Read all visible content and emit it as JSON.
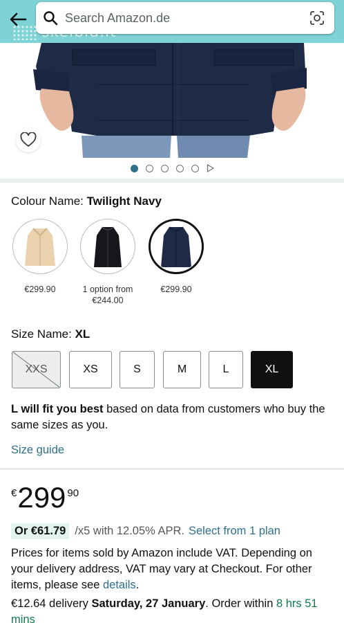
{
  "search": {
    "placeholder": "Search Amazon.de",
    "watermark": "skelbiu.lt"
  },
  "carousel": {
    "dot_count": 5,
    "active_index": 0
  },
  "colour": {
    "label": "Colour Name: ",
    "selected_value": "Twilight Navy",
    "options": [
      {
        "color": "#e9d2ad",
        "price": "€299.90"
      },
      {
        "color": "#16171a",
        "price": "1 option from €244.00"
      },
      {
        "color": "#1f2a47",
        "price": "€299.90"
      }
    ]
  },
  "size": {
    "label": "Size Name: ",
    "selected_value": "XL",
    "options": [
      {
        "label": "XXS",
        "state": "unavailable"
      },
      {
        "label": "XS",
        "state": "available"
      },
      {
        "label": "S",
        "state": "available"
      },
      {
        "label": "M",
        "state": "available"
      },
      {
        "label": "L",
        "state": "available"
      },
      {
        "label": "XL",
        "state": "selected"
      }
    ],
    "fit_bold": "L will fit you best",
    "fit_rest": " based on data from customers who buy the same sizes as you.",
    "guide_link": "Size guide"
  },
  "price": {
    "symbol": "€",
    "whole": "299",
    "fraction": "90"
  },
  "installment": {
    "badge": "Or €61.79",
    "terms": "/x5 with 12.05% APR.",
    "link": "Select from 1 plan"
  },
  "vat": {
    "text": "Prices for items sold by Amazon include VAT. Depending on your delivery address, VAT may vary at Checkout. For other items, please see ",
    "link": "details",
    "end": "."
  },
  "delivery": {
    "prefix": "€12.64 delivery ",
    "date": "Saturday, 27 January",
    "middle": ". Order within ",
    "countdown": "8 hrs 51 mins"
  },
  "colors": {
    "link": "#2f6f8b",
    "accent_top": "#7fd3d6",
    "jacket_navy": "#1f2a47",
    "installment_badge": "#e3f4ec",
    "countdown_green": "#107a4a"
  }
}
